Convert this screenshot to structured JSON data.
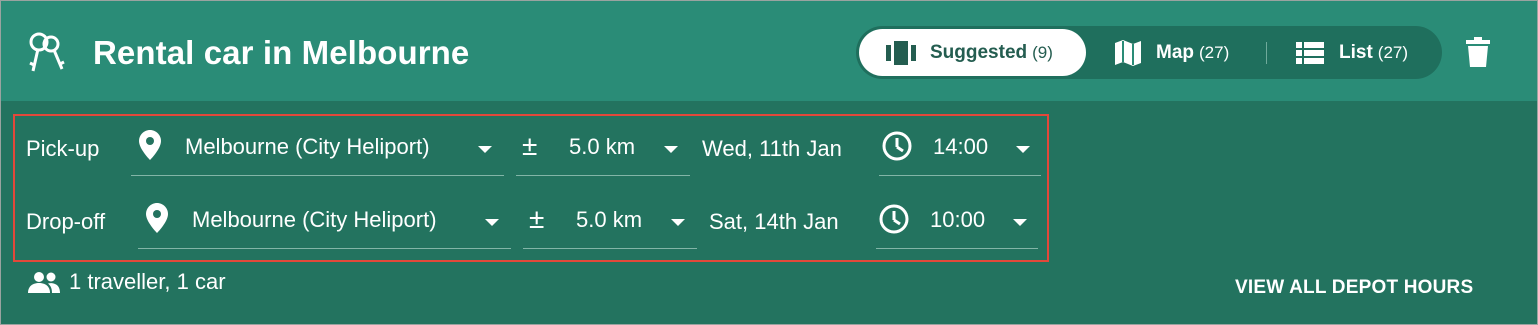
{
  "header": {
    "title": "Rental car in Melbourne",
    "view_toggle": [
      {
        "label": "Suggested",
        "count": "(9)",
        "icon": "carousel-icon",
        "active": true
      },
      {
        "label": "Map",
        "count": "(27)",
        "icon": "map-icon",
        "active": false
      },
      {
        "label": "List",
        "count": "(27)",
        "icon": "list-icon",
        "active": false
      }
    ]
  },
  "pickup": {
    "label": "Pick-up",
    "location": "Melbourne (City Heliport)",
    "radius": "5.0 km",
    "date": "Wed, 11th Jan",
    "time": "14:00"
  },
  "dropoff": {
    "label": "Drop-off",
    "location": "Melbourne (City Heliport)",
    "radius": "5.0 km",
    "date": "Sat, 14th Jan",
    "time": "10:00"
  },
  "travellers": "1 traveller, 1 car",
  "depot_link": "VIEW ALL DEPOT HOURS",
  "colors": {
    "header_bg": "#2a8c77",
    "body_bg": "#23735f",
    "highlight_border": "#e2483a",
    "active_text": "#245d50"
  }
}
